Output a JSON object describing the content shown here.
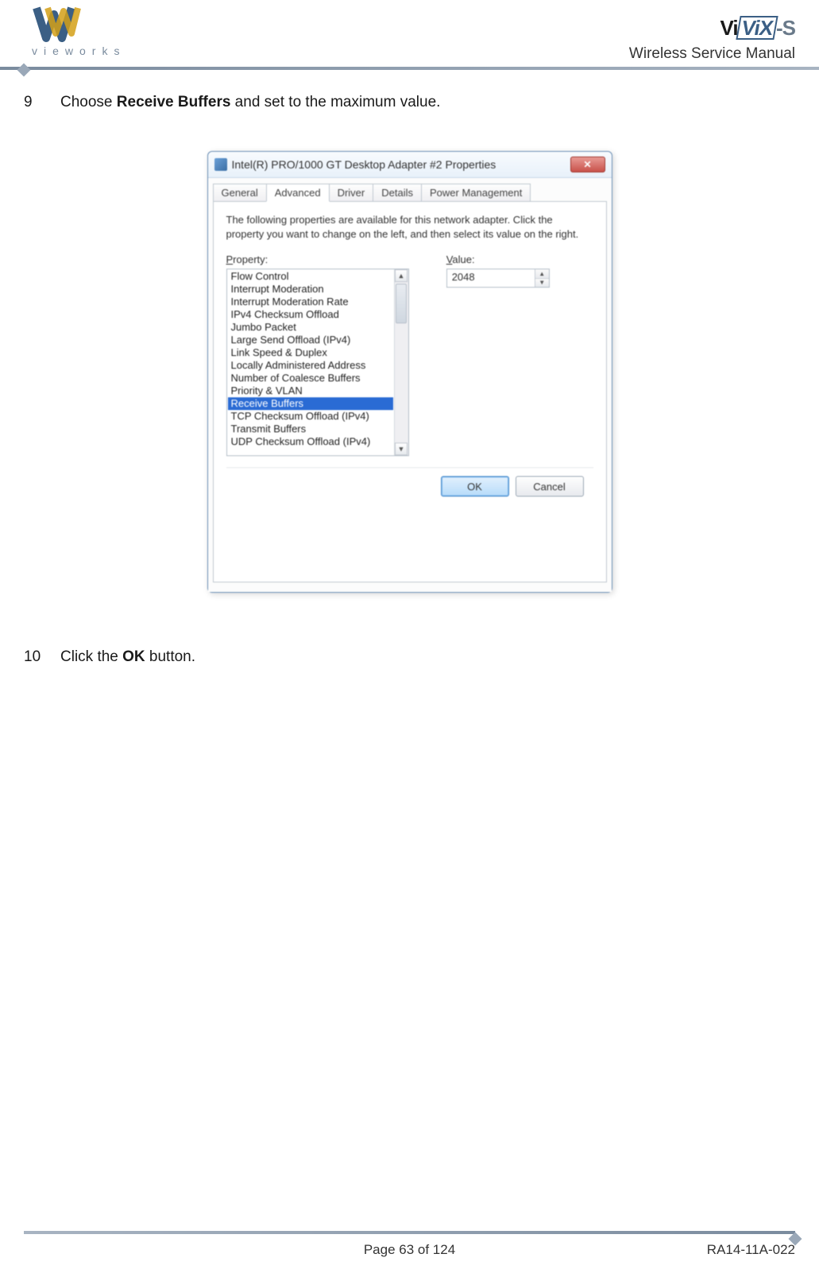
{
  "header": {
    "brand_name": "vieworks",
    "product_name_left": "Vi",
    "product_name_box": "ViX",
    "product_name_suffix": "-S",
    "subtitle": "Wireless Service Manual"
  },
  "steps": {
    "s9": {
      "num": "9",
      "pre": "Choose ",
      "bold": "Receive Buffers",
      "post": " and set to the maximum value."
    },
    "s10": {
      "num": "10",
      "pre": "Click the ",
      "bold": "OK",
      "post": " button."
    }
  },
  "dialog": {
    "title": "Intel(R) PRO/1000 GT Desktop Adapter #2 Properties",
    "close_x": "✕",
    "tabs": {
      "general": "General",
      "advanced": "Advanced",
      "driver": "Driver",
      "details": "Details",
      "power": "Power Management"
    },
    "desc": "The following properties are available for this network adapter. Click the property you want to change on the left, and then select its value on the right.",
    "property_label": "Property:",
    "value_label": "Value:",
    "value": "2048",
    "items": [
      "Flow Control",
      "Interrupt Moderation",
      "Interrupt Moderation Rate",
      "IPv4 Checksum Offload",
      "Jumbo Packet",
      "Large Send Offload (IPv4)",
      "Link Speed & Duplex",
      "Locally Administered Address",
      "Number of Coalesce Buffers",
      "Priority & VLAN",
      "Receive Buffers",
      "TCP Checksum Offload (IPv4)",
      "Transmit Buffers",
      "UDP Checksum Offload (IPv4)"
    ],
    "selected_index": 10,
    "ok_label": "OK",
    "cancel_label": "Cancel"
  },
  "footer": {
    "page": "Page 63 of 124",
    "doc_id": "RA14-11A-022"
  }
}
